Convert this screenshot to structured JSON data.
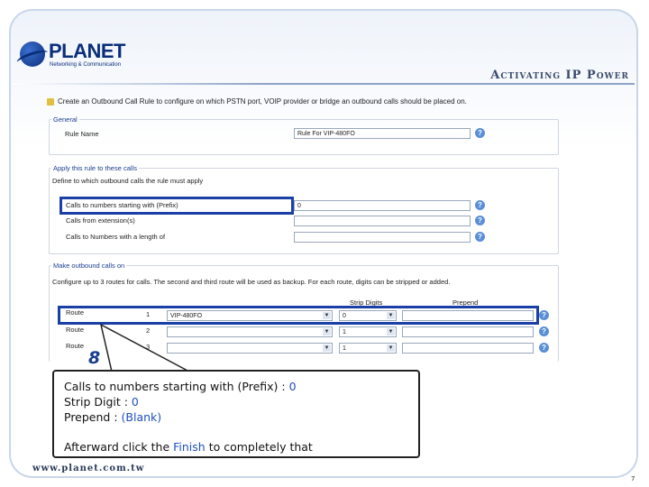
{
  "header": {
    "logo_text": "PLANET",
    "logo_subtext": "Networking & Communication",
    "title": "Activating IP Power"
  },
  "screen": {
    "intro": "Create an Outbound Call Rule to configure on which PSTN port, VOIP provider or bridge an outbound calls should be placed on.",
    "general": {
      "legend": "General",
      "rule_name_label": "Rule Name",
      "rule_name_value": "Rule For VIP-480FO"
    },
    "apply": {
      "legend": "Apply this rule to these calls",
      "define_text": "Define to which outbound calls the rule must apply",
      "prefix_label": "Calls to numbers starting with (Prefix)",
      "prefix_value": "0",
      "extension_label": "Calls from extension(s)",
      "extension_value": "",
      "length_label": "Calls to Numbers with a length of",
      "length_value": ""
    },
    "make": {
      "legend": "Make outbound calls on",
      "description": "Configure up to 3 routes for calls. The second and third route will be used as backup. For each route, digits can be stripped or added.",
      "col_strip": "Strip Digits",
      "col_prepend": "Prepend",
      "routes": [
        {
          "label": "Route",
          "num": "1",
          "provider": "VIP-480FO",
          "strip": "0",
          "prepend": ""
        },
        {
          "label": "Route",
          "num": "2",
          "provider": "",
          "strip": "1",
          "prepend": ""
        },
        {
          "label": "Route",
          "num": "3",
          "provider": "",
          "strip": "1",
          "prepend": ""
        }
      ]
    },
    "help_glyph": "?"
  },
  "step_number": "8",
  "callout": {
    "line1_label": "Calls to numbers starting with (Prefix) : ",
    "line1_value": "0",
    "line2_label": "Strip Digit : ",
    "line2_value": "0",
    "line3_label": "Prepend : ",
    "line3_value": "(Blank)",
    "line4_a": "Afterward click the ",
    "line4_b": "Finish",
    "line4_c": " to completely that"
  },
  "footer": {
    "url": "www.planet.com.tw",
    "page": "7"
  },
  "colors": {
    "accent": "#1a3fa6",
    "value": "#1f4fbf",
    "brand": "#0a2e7a"
  }
}
